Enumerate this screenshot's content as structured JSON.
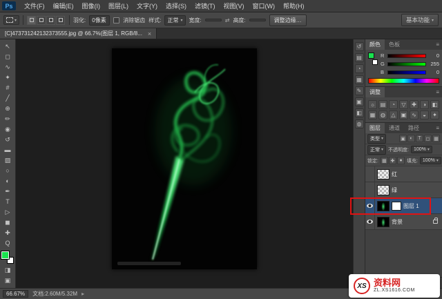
{
  "app": {
    "logo": "Ps",
    "workspace": "基本功能"
  },
  "menu": {
    "items": [
      "文件(F)",
      "编辑(E)",
      "图像(I)",
      "图层(L)",
      "文字(Y)",
      "选择(S)",
      "滤镜(T)",
      "视图(V)",
      "窗口(W)",
      "帮助(H)"
    ]
  },
  "options": {
    "feather_label": "羽化:",
    "feather_value": "0像素",
    "antialias": "消除锯齿",
    "style_label": "样式:",
    "style_value": "正常",
    "width_label": "宽度:",
    "height_label": "高度:",
    "swap_glyph": "⇄",
    "refine_edge": "调整边缘…"
  },
  "doc": {
    "tab_title": "[C]473731242132373555.jpg @ 66.7%(图层 1, RGB/8...",
    "close_label": "×"
  },
  "tools": [
    {
      "name": "move-tool",
      "glyph": "↖"
    },
    {
      "name": "marquee-tool",
      "glyph": "◻"
    },
    {
      "name": "lasso-tool",
      "glyph": "∿"
    },
    {
      "name": "quick-selection-tool",
      "glyph": "✦"
    },
    {
      "name": "crop-tool",
      "glyph": "#"
    },
    {
      "name": "eyedropper-tool",
      "glyph": "╱"
    },
    {
      "name": "healing-brush-tool",
      "glyph": "⊕"
    },
    {
      "name": "brush-tool",
      "glyph": "✏"
    },
    {
      "name": "clone-stamp-tool",
      "glyph": "◉"
    },
    {
      "name": "history-brush-tool",
      "glyph": "↺"
    },
    {
      "name": "eraser-tool",
      "glyph": "▬"
    },
    {
      "name": "gradient-tool",
      "glyph": "▨"
    },
    {
      "name": "blur-tool",
      "glyph": "○"
    },
    {
      "name": "dodge-tool",
      "glyph": "◐"
    },
    {
      "name": "pen-tool",
      "glyph": "✒"
    },
    {
      "name": "type-tool",
      "glyph": "T"
    },
    {
      "name": "path-selection-tool",
      "glyph": "▷"
    },
    {
      "name": "shape-tool",
      "glyph": "◼"
    },
    {
      "name": "hand-tool",
      "glyph": "✚"
    },
    {
      "name": "zoom-tool",
      "glyph": "Q"
    }
  ],
  "toolbar_extras": {
    "quick_mask_glyph": "◨",
    "screen_mode_glyph": "▣"
  },
  "dock_icons": [
    {
      "name": "history-panel-icon",
      "glyph": "↺"
    },
    {
      "name": "properties-panel-icon",
      "glyph": "▤"
    },
    {
      "name": "info-panel-icon",
      "glyph": "◔"
    },
    {
      "name": "navigator-panel-icon",
      "glyph": "▦"
    },
    {
      "name": "character-panel-icon",
      "glyph": "✎"
    },
    {
      "name": "paragraph-panel-icon",
      "glyph": "▣"
    },
    {
      "name": "styles-panel-icon",
      "glyph": "◧"
    },
    {
      "name": "brush-panel-icon",
      "glyph": "◍"
    }
  ],
  "color_panel": {
    "tab_color": "颜色",
    "tab_swatches": "色板",
    "channels": [
      {
        "label": "R",
        "value": "0",
        "grad": "r"
      },
      {
        "label": "G",
        "value": "255",
        "grad": "g"
      },
      {
        "label": "B",
        "value": "0",
        "grad": "b"
      }
    ]
  },
  "adjust_panel": {
    "tab": "调整",
    "icons": [
      "☼",
      "▤",
      "◔",
      "▽",
      "✚",
      "◑",
      "◧",
      "▦",
      "◍",
      "△",
      "▣",
      "∿",
      "◒",
      "✦"
    ]
  },
  "layers_panel": {
    "tabs": [
      "图层",
      "通道",
      "路径"
    ],
    "filter_label": "类型",
    "filter_icons": [
      "▣",
      "◐",
      "T",
      "◻",
      "▦"
    ],
    "blend_mode": "正常",
    "opacity_label": "不透明度:",
    "opacity_value": "100%",
    "lock_label": "锁定:",
    "lock_icons": [
      "▦",
      "✚",
      "●"
    ],
    "fill_label": "填充:",
    "fill_value": "100%",
    "layers": [
      {
        "name": "红",
        "thumb": "checker",
        "eye": false,
        "selected": false,
        "locked": false,
        "mask": false
      },
      {
        "name": "绿",
        "thumb": "checker",
        "eye": false,
        "selected": false,
        "locked": false,
        "mask": false
      },
      {
        "name": "图层 1",
        "thumb": "smoke",
        "eye": true,
        "selected": true,
        "locked": false,
        "mask": true
      },
      {
        "name": "背景",
        "thumb": "smoke",
        "eye": true,
        "selected": false,
        "locked": true,
        "mask": false
      }
    ],
    "bottom_icons": [
      {
        "name": "link-layers-icon",
        "glyph": "∞"
      },
      {
        "name": "layer-style-icon",
        "glyph": "fx"
      },
      {
        "name": "add-mask-icon",
        "glyph": "◧"
      },
      {
        "name": "new-adjustment-icon",
        "glyph": "◐"
      },
      {
        "name": "new-group-icon",
        "glyph": "▣"
      },
      {
        "name": "new-layer-icon",
        "glyph": "⊞"
      },
      {
        "name": "delete-layer-icon",
        "glyph": "✖"
      }
    ]
  },
  "status": {
    "zoom": "66.67%",
    "doc_info": "文档:2.60M/5.32M",
    "arrow": "▸"
  },
  "watermark": {
    "logo": "XS",
    "site": "资料网",
    "domain": "ZL.XS1616.COM"
  },
  "colors": {
    "foreground_green": "#19e24e",
    "annotation_red": "#e11212",
    "smoke_green": "#2fe25f"
  }
}
